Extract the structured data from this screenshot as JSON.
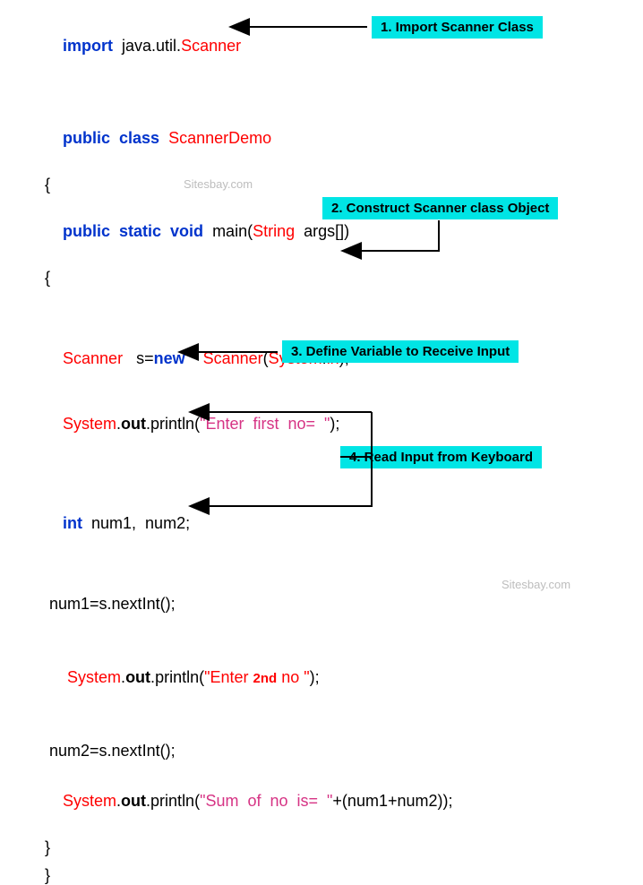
{
  "code": {
    "l1": {
      "kw": "import",
      "pkg": "  java.util.",
      "cls": "Scanner"
    },
    "l2": {
      "kw1": "public",
      "kw2": "  class  ",
      "cls": "ScannerDemo"
    },
    "l3": "{",
    "l4": {
      "kw1": "public",
      "kw2": "  static",
      "kw3": "  void  ",
      "id": "main(",
      "arg1": "String",
      "arg2": "  args[])"
    },
    "l5": "{",
    "l6": {
      "t1": "Scanner",
      "t2": "   s=",
      "kw": "new",
      "t3": "    ",
      "cls": "Scanner",
      "paren": "(",
      "sys": "System",
      "dot": ".",
      "in": "in",
      "close": ");"
    },
    "l7": {
      "sys": "System",
      "dot1": ".",
      "out": "out",
      "dot2": ".",
      "pr": "println(",
      "str": "\"Enter  first  no=  \"",
      "close": ");"
    },
    "l8": {
      "kw": "int",
      "ids": "  num1,  num2;"
    },
    "l9": " num1=s.nextInt();",
    "l10": {
      "lead": " ",
      "sys": "System",
      "dot1": ".",
      "out": "out",
      "dot2": ".",
      "pr": "println(",
      "q1": "\"",
      "s1": "Enter ",
      "s2": "2nd",
      "s3": " no ",
      "q2": "\"",
      "close": ");"
    },
    "l11": " num2=s.nextInt();",
    "l12": {
      "sys": "System",
      "dot1": ".",
      "out": "out",
      "dot2": ".",
      "pr": "println(",
      "str": "\"Sum  of  no  is=  \"",
      "plus": "+(num1+num2));"
    },
    "l13": "}",
    "l14": "}"
  },
  "callouts": {
    "c1": "1. Import Scanner Class",
    "c2": "2. Construct Scanner class Object",
    "c3": "3. Define Variable to Receive Input",
    "c4": "4. Read Input from Keyboard"
  },
  "watermark": "Sitesbay.com"
}
